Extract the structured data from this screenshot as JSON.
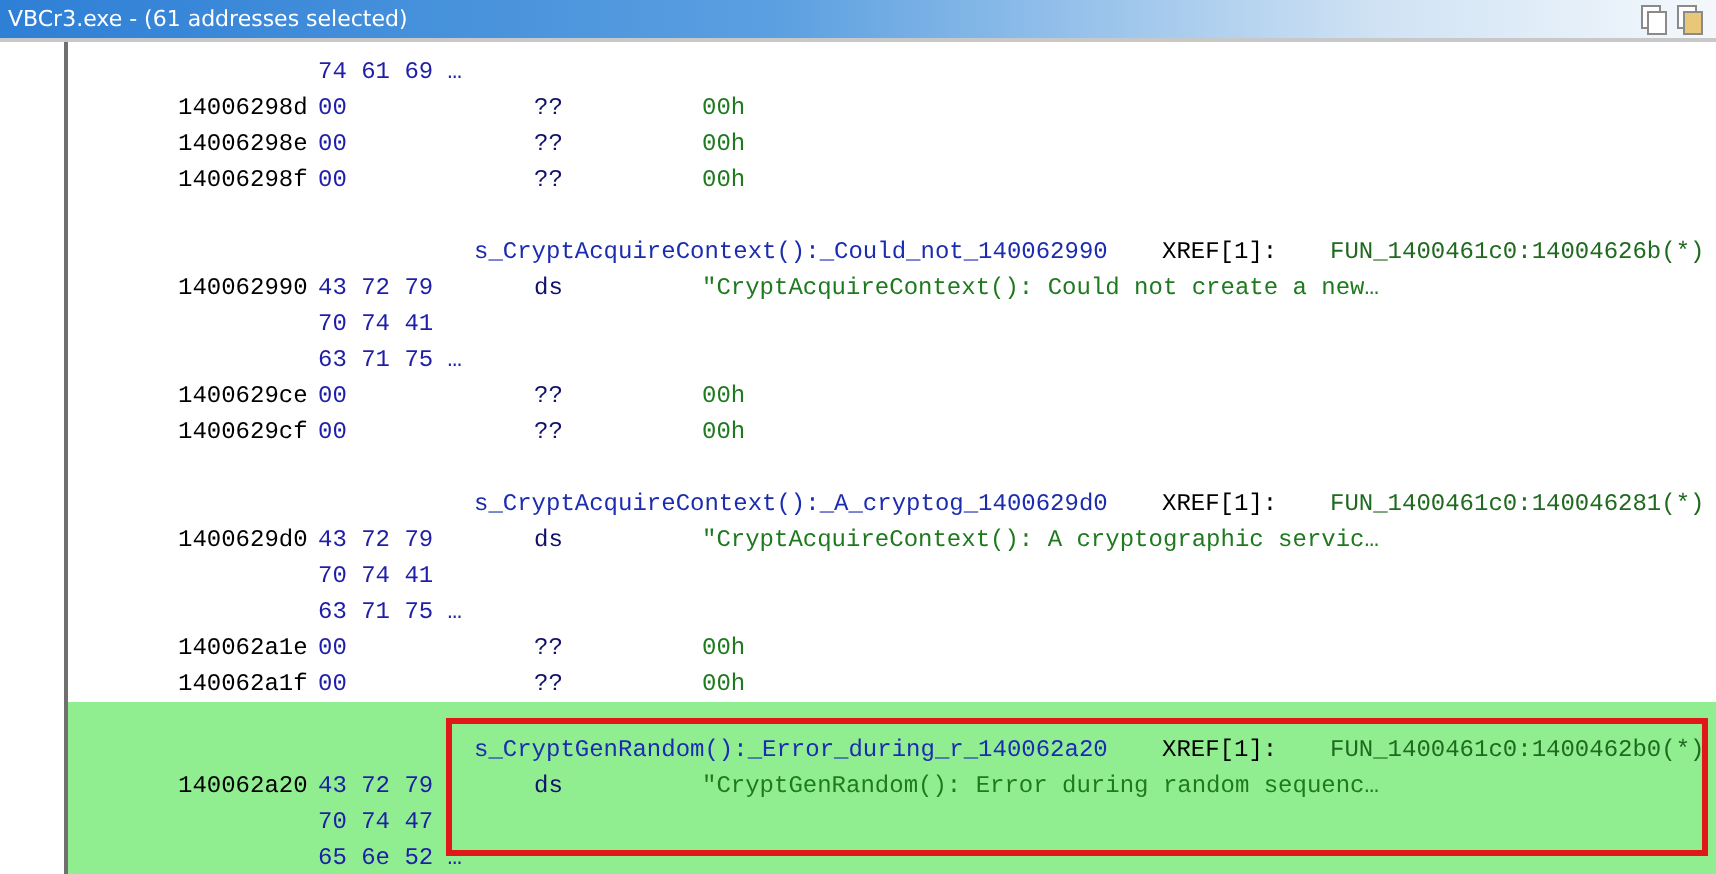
{
  "window": {
    "title": "VBCr3.exe - (61 addresses selected)"
  },
  "listing": [
    {
      "kind": "bytes",
      "bytes": "74 61 69 …",
      "selected": false
    },
    {
      "kind": "data",
      "address": "14006298d",
      "bytes": "00",
      "mnemonic": "??",
      "operand": "00h",
      "selected": false
    },
    {
      "kind": "data",
      "address": "14006298e",
      "bytes": "00",
      "mnemonic": "??",
      "operand": "00h",
      "selected": false
    },
    {
      "kind": "data",
      "address": "14006298f",
      "bytes": "00",
      "mnemonic": "??",
      "operand": "00h",
      "selected": false
    },
    {
      "kind": "blank",
      "selected": false
    },
    {
      "kind": "label",
      "label": "s_CryptAcquireContext():_Could_not_140062990",
      "xref": "XREF[1]:",
      "ref": "FUN_1400461c0:14004626b(*)",
      "selected": false
    },
    {
      "kind": "data",
      "address": "140062990",
      "bytes": "43 72 79",
      "mnemonic": "ds",
      "operand": "\"CryptAcquireContext(): Could not create a new…",
      "selected": false
    },
    {
      "kind": "bytes",
      "bytes": "70 74 41",
      "selected": false
    },
    {
      "kind": "bytes",
      "bytes": "63 71 75 …",
      "selected": false
    },
    {
      "kind": "data",
      "address": "1400629ce",
      "bytes": "00",
      "mnemonic": "??",
      "operand": "00h",
      "selected": false
    },
    {
      "kind": "data",
      "address": "1400629cf",
      "bytes": "00",
      "mnemonic": "??",
      "operand": "00h",
      "selected": false
    },
    {
      "kind": "blank",
      "selected": false
    },
    {
      "kind": "label",
      "label": "s_CryptAcquireContext():_A_cryptog_1400629d0",
      "xref": "XREF[1]:",
      "ref": "FUN_1400461c0:140046281(*)",
      "selected": false
    },
    {
      "kind": "data",
      "address": "1400629d0",
      "bytes": "43 72 79",
      "mnemonic": "ds",
      "operand": "\"CryptAcquireContext(): A cryptographic servic…",
      "selected": false
    },
    {
      "kind": "bytes",
      "bytes": "70 74 41",
      "selected": false
    },
    {
      "kind": "bytes",
      "bytes": "63 71 75 …",
      "selected": false
    },
    {
      "kind": "data",
      "address": "140062a1e",
      "bytes": "00",
      "mnemonic": "??",
      "operand": "00h",
      "selected": false
    },
    {
      "kind": "data",
      "address": "140062a1f",
      "bytes": "00",
      "mnemonic": "??",
      "operand": "00h",
      "selected": false
    },
    {
      "kind": "label",
      "label": "s_CryptGenRandom():_Error_during_r_140062a20",
      "xref": "XREF[1]:",
      "ref": "FUN_1400461c0:1400462b0(*)",
      "selected": true,
      "boxed": true
    },
    {
      "kind": "data",
      "address": "140062a20",
      "bytes": "43 72 79",
      "mnemonic": "ds",
      "operand": "\"CryptGenRandom(): Error during random sequenc…",
      "selected": true,
      "boxed": true
    },
    {
      "kind": "bytes",
      "bytes": "70 74 47",
      "selected": true,
      "boxed": true
    },
    {
      "kind": "bytes",
      "bytes": "65 6e 52 …",
      "selected": true,
      "boxed": false
    }
  ]
}
